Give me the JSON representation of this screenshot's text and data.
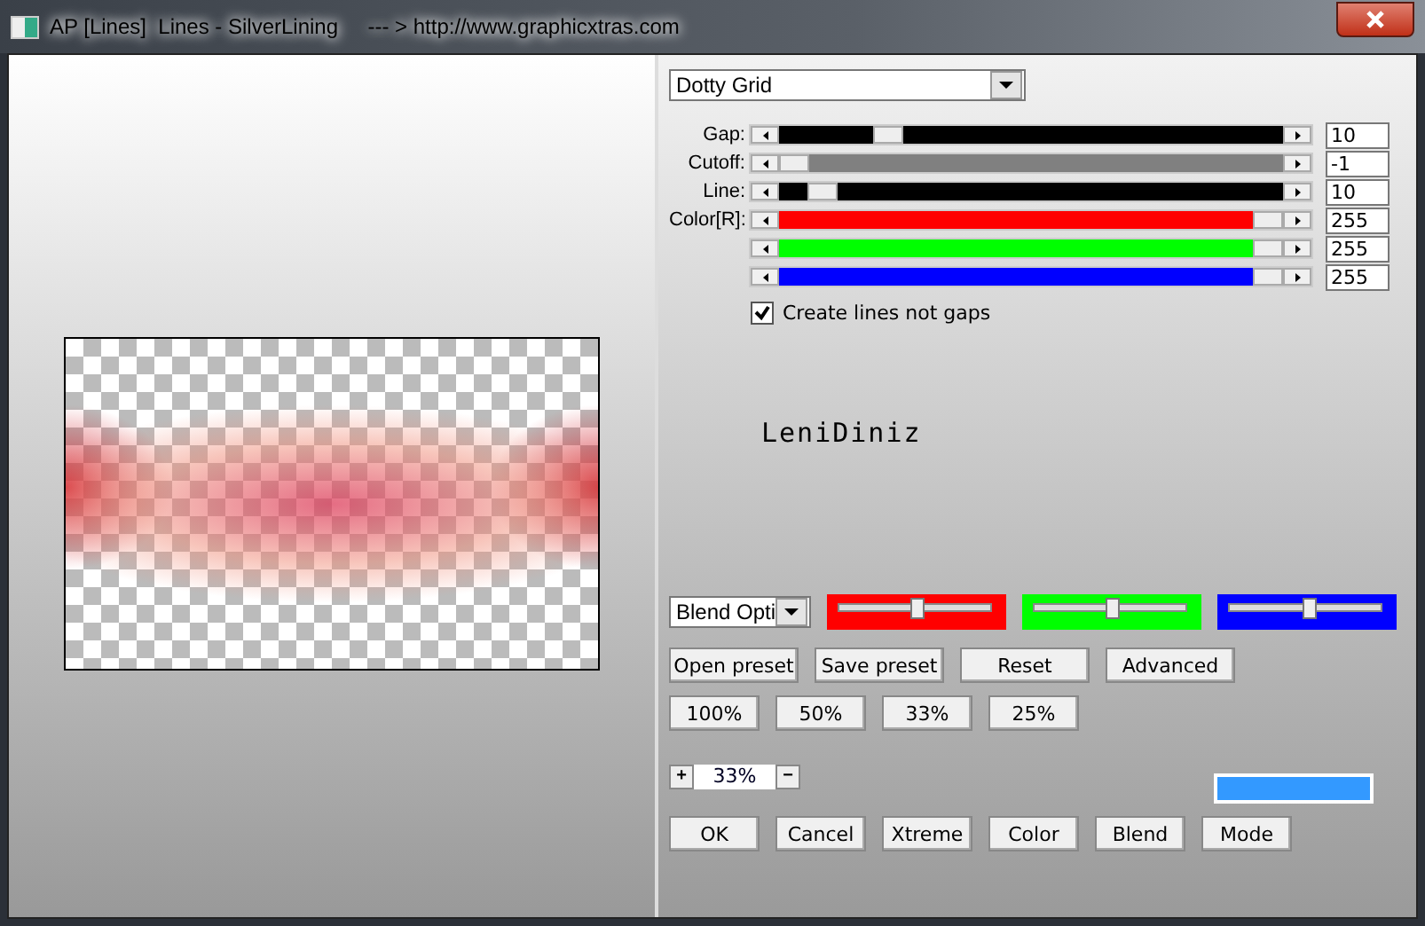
{
  "window": {
    "title": "AP [Lines]  Lines - SilverLining     --- > http://www.graphicxtras.com"
  },
  "effect_dropdown": {
    "value": "Dotty Grid"
  },
  "sliders": [
    {
      "label": "Gap:",
      "level": 0.2,
      "color": "#000000",
      "value": "10"
    },
    {
      "label": "Cutoff:",
      "level": 0.0,
      "color": "#808080",
      "value": "-1"
    },
    {
      "label": "Line:",
      "level": 0.06,
      "color": "#000000",
      "value": "10"
    },
    {
      "label": "Color[R]:",
      "level": 1.0,
      "color": "#ff0000",
      "value": "255"
    },
    {
      "level": 1.0,
      "color": "#00ff00",
      "value": "255"
    },
    {
      "level": 1.0,
      "color": "#0000ff",
      "value": "255"
    }
  ],
  "create_lines_checkbox": {
    "label": "Create lines not gaps",
    "checked": true
  },
  "logo": {
    "text": "LeniDiniz"
  },
  "blend_dropdown": {
    "value": "Blend Opti"
  },
  "channel_trackbars": [
    {
      "color": "#ff0000",
      "level": 0.5
    },
    {
      "color": "#00ff00",
      "level": 0.5
    },
    {
      "color": "#0000ff",
      "level": 0.52
    }
  ],
  "preset_buttons": [
    "Open preset",
    "Save preset",
    "Reset",
    "Advanced"
  ],
  "zoom_buttons": [
    "100%",
    "50%",
    "33%",
    "25%"
  ],
  "zoom_field": {
    "plus": "+",
    "value": "33%",
    "minus": "−"
  },
  "color_swatch": {
    "color": "#3399ff"
  },
  "bottom_buttons": [
    "OK",
    "Cancel",
    "Xtreme",
    "Color",
    "Blend",
    "Mode"
  ]
}
